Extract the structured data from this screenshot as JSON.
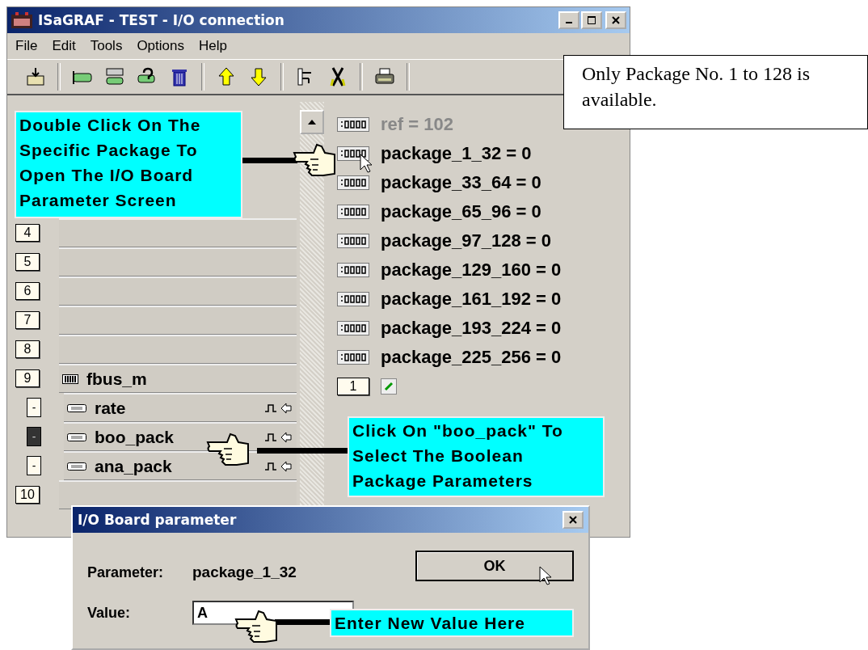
{
  "window": {
    "title": "ISaGRAF - TEST - I/O connection"
  },
  "menu": [
    "File",
    "Edit",
    "Tools",
    "Options",
    "Help"
  ],
  "slots": [
    {
      "number": "4"
    },
    {
      "number": "5"
    },
    {
      "number": "6"
    },
    {
      "number": "7"
    },
    {
      "number": "8"
    },
    {
      "number": "9",
      "board": "fbus_m",
      "children": [
        {
          "marker": "-",
          "name": "rate",
          "selected": false
        },
        {
          "marker": "-",
          "name": "boo_pack",
          "selected": true
        },
        {
          "marker": "-",
          "name": "ana_pack",
          "selected": false
        }
      ]
    },
    {
      "number": "10"
    }
  ],
  "parameters": [
    {
      "text": "ref = 102",
      "disabled": true
    },
    {
      "text": "package_1_32 = 0",
      "disabled": false
    },
    {
      "text": "package_33_64 = 0",
      "disabled": false
    },
    {
      "text": "package_65_96 = 0",
      "disabled": false
    },
    {
      "text": "package_97_128 = 0",
      "disabled": false
    },
    {
      "text": "package_129_160 = 0",
      "disabled": false
    },
    {
      "text": "package_161_192 = 0",
      "disabled": false
    },
    {
      "text": "package_193_224 = 0",
      "disabled": false
    },
    {
      "text": "package_225_256 = 0",
      "disabled": false
    }
  ],
  "channel": {
    "number": "1"
  },
  "callouts": [
    {
      "kind": "note",
      "text": "Only Package No. 1 to 128 is available."
    },
    {
      "kind": "hint",
      "text": "Double Click On The Specific Package To Open The I/O Board Parameter Screen"
    },
    {
      "kind": "hint",
      "text": "Click On \"boo_pack\" To Select The Boolean Package Parameters"
    },
    {
      "kind": "hint",
      "text": "Enter New Value Here"
    }
  ],
  "dialog": {
    "title": "I/O Board parameter",
    "parameter_label": "Parameter:",
    "parameter_value": "package_1_32",
    "value_label": "Value:",
    "value": "A",
    "ok": "OK"
  }
}
